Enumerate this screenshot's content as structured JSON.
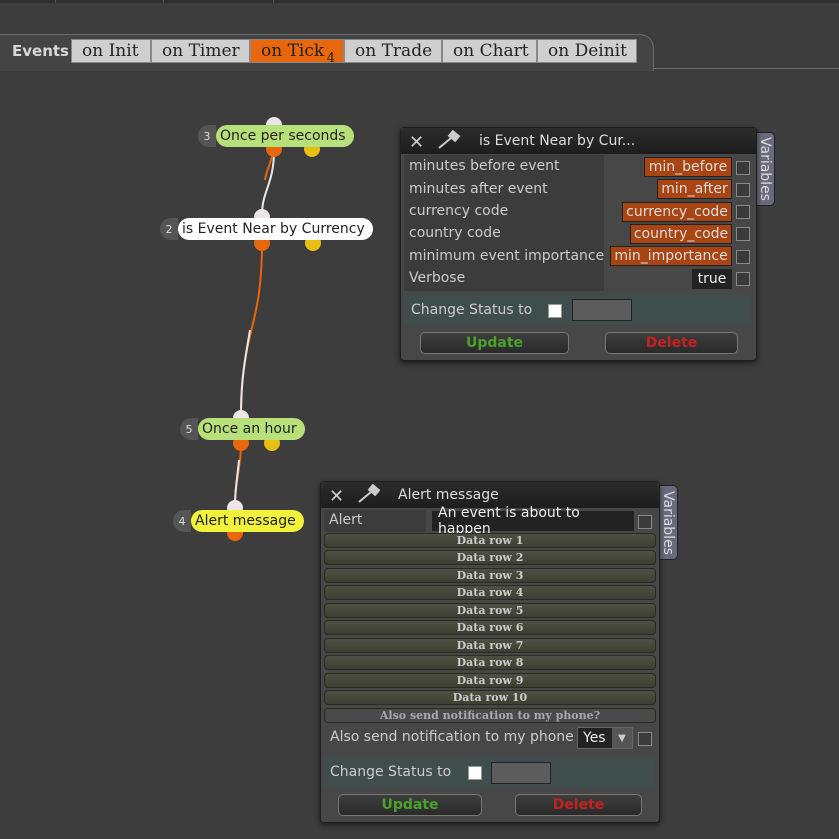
{
  "tabs": {
    "events_label": "Events",
    "items": [
      {
        "label": "on Init"
      },
      {
        "label": "on Timer"
      },
      {
        "label": "on Tick",
        "count": "4"
      },
      {
        "label": "on Trade"
      },
      {
        "label": "on Chart"
      },
      {
        "label": "on Deinit"
      }
    ]
  },
  "nodes": [
    {
      "num": "3",
      "label": "Once per seconds",
      "color": "#b7e07a"
    },
    {
      "num": "2",
      "label": "is Event Near by Currency",
      "color": "#ffffff"
    },
    {
      "num": "5",
      "label": "Once an hour",
      "color": "#b7e07a"
    },
    {
      "num": "4",
      "label": "Alert message",
      "color": "#f2f23a"
    }
  ],
  "panel1": {
    "title": "is Event Near by Cur...",
    "variables_tab": "Variables",
    "rows": [
      {
        "label": "minutes before event",
        "value": "min_before"
      },
      {
        "label": "minutes after event",
        "value": "min_after"
      },
      {
        "label": "currency code",
        "value": "currency_code"
      },
      {
        "label": "country code",
        "value": "country_code"
      },
      {
        "label": "minimum event importance",
        "value": "min_importance"
      },
      {
        "label": "Verbose",
        "value": "true"
      }
    ],
    "change_status": "Change Status to",
    "update": "Update",
    "delete": "Delete"
  },
  "panel2": {
    "title": "Alert message",
    "variables_tab": "Variables",
    "alert_label": "Alert",
    "alert_value": "An event is about to happen",
    "data_rows": [
      "Data row 1",
      "Data row 2",
      "Data row 3",
      "Data row 4",
      "Data row 5",
      "Data row 6",
      "Data row 7",
      "Data row 8",
      "Data row 9",
      "Data row 10"
    ],
    "notify_header": "Also send notification to my phone?",
    "notify_label": "Also send notification to my phone",
    "notify_value": "Yes",
    "change_status": "Change Status to",
    "update": "Update",
    "delete": "Delete"
  },
  "colors": {
    "accent": "#e8660c",
    "update": "#4aa329",
    "delete": "#c42121",
    "value_box": "#a84512"
  }
}
